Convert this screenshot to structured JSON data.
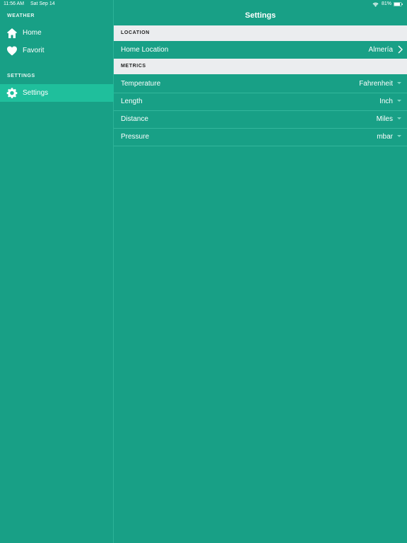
{
  "status_bar": {
    "time": "11:56 AM",
    "date": "Sat Sep 14",
    "battery": "81%"
  },
  "sidebar": {
    "weather_section": "WEATHER",
    "settings_section": "SETTINGS",
    "items": [
      {
        "label": "Home",
        "icon": "home-icon"
      },
      {
        "label": "Favorit",
        "icon": "heart-icon"
      },
      {
        "label": "Settings",
        "icon": "gear-icon",
        "active": true
      }
    ]
  },
  "main": {
    "title": "Settings",
    "location_header": "LOCATION",
    "metrics_header": "METRICS",
    "home_location": {
      "label": "Home Location",
      "value": "Almería"
    },
    "metrics": [
      {
        "label": "Temperature",
        "value": "Fahrenheit"
      },
      {
        "label": "Length",
        "value": "Inch"
      },
      {
        "label": "Distance",
        "value": "Miles"
      },
      {
        "label": "Pressure",
        "value": "mbar"
      }
    ]
  },
  "colors": {
    "background": "#18a086",
    "active_item": "#1fbf9c",
    "section_header_bg": "#ebedef"
  }
}
